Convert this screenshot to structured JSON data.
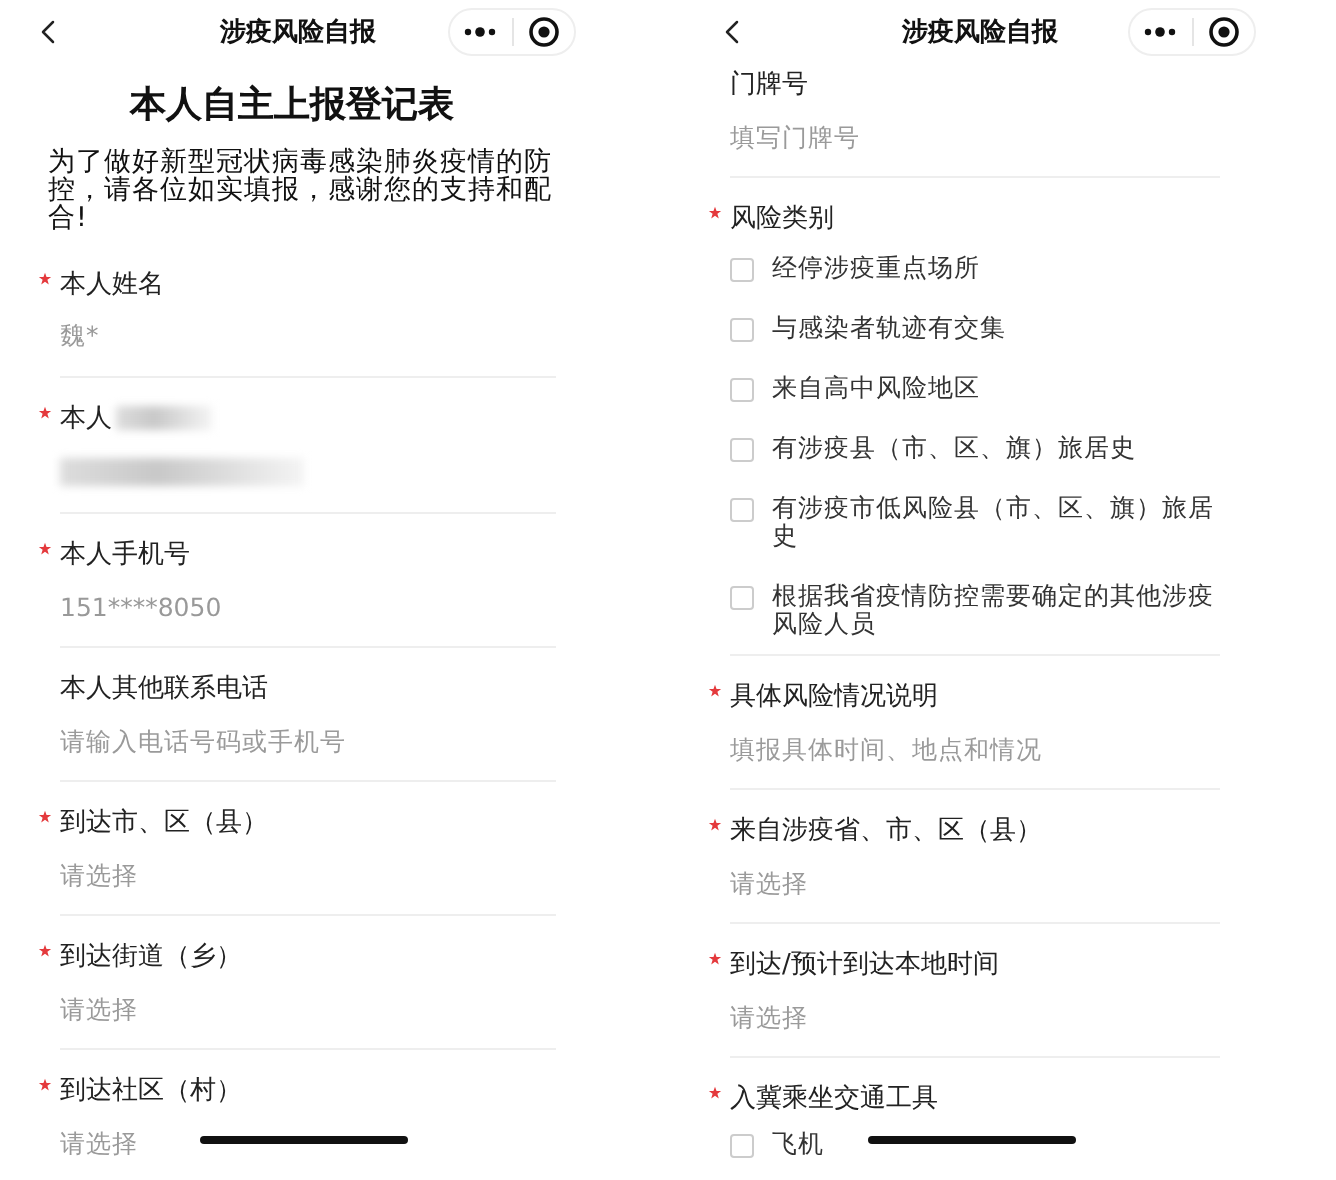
{
  "panels": [
    {
      "header": {
        "title": "涉疫风险自报"
      },
      "form_title": "本人自主上报登记表",
      "intro": "为了做好新型冠状病毒感染肺炎疫情的防控，请各位如实填报，感谢您的支持和配合!",
      "fields": [
        {
          "kind": "text",
          "label": "本人姓名",
          "required": true,
          "value": "魏*"
        },
        {
          "kind": "redacted",
          "label": "本人",
          "required": true
        },
        {
          "kind": "text",
          "label": "本人手机号",
          "required": true,
          "value": "151****8050"
        },
        {
          "kind": "text",
          "label": "本人其他联系电话",
          "required": false,
          "placeholder": "请输入电话号码或手机号"
        },
        {
          "kind": "text",
          "label": "到达市、区（县）",
          "required": true,
          "placeholder": "请选择"
        },
        {
          "kind": "text",
          "label": "到达街道（乡）",
          "required": true,
          "placeholder": "请选择"
        },
        {
          "kind": "text",
          "label": "到达社区（村）",
          "required": true,
          "placeholder": "请选择"
        }
      ]
    },
    {
      "header": {
        "title": "涉疫风险自报"
      },
      "fields": [
        {
          "kind": "text",
          "label": "门牌号",
          "required": false,
          "placeholder": "填写门牌号"
        },
        {
          "kind": "checkboxes",
          "label": "风险类别",
          "required": true,
          "options": [
            {
              "label": "经停涉疫重点场所",
              "checked": false
            },
            {
              "label": "与感染者轨迹有交集",
              "checked": false
            },
            {
              "label": "来自高中风险地区",
              "checked": false
            },
            {
              "label": "有涉疫县（市、区、旗）旅居史",
              "checked": false
            },
            {
              "label": "有涉疫市低风险县（市、区、旗）旅居史",
              "checked": false
            },
            {
              "label": "根据我省疫情防控需要确定的其他涉疫风险人员",
              "checked": false
            }
          ]
        },
        {
          "kind": "text",
          "label": "具体风险情况说明",
          "required": true,
          "placeholder": "填报具体时间、地点和情况"
        },
        {
          "kind": "text",
          "label": "来自涉疫省、市、区（县）",
          "required": true,
          "placeholder": "请选择"
        },
        {
          "kind": "text",
          "label": "到达/预计到达本地时间",
          "required": true,
          "placeholder": "请选择"
        },
        {
          "kind": "checkboxes",
          "label": "入冀乘坐交通工具",
          "required": true,
          "options": [
            {
              "label": "飞机",
              "checked": false
            }
          ]
        }
      ]
    }
  ]
}
